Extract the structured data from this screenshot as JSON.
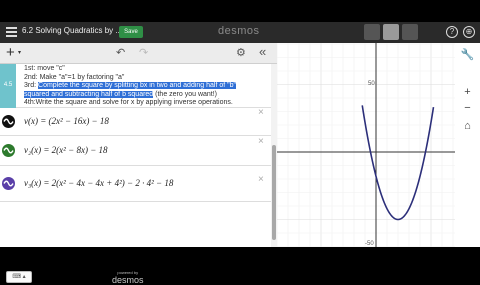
{
  "header": {
    "title": "6.2 Solving Quadratics by ...",
    "save_label": "Save",
    "brand": "desmos",
    "help_symbol": "?",
    "globe_symbol": "⊕"
  },
  "toolbar": {
    "add_symbol": "+",
    "caret": "▾",
    "undo_symbol": "↶",
    "redo_symbol": "↷",
    "gear_symbol": "⚙",
    "collapse_symbol": "«"
  },
  "note": {
    "tab_label": "4.5",
    "lines": [
      {
        "before": "1st: move \"c\"",
        "highlight": "",
        "after": ""
      },
      {
        "before": "2nd: Make \"a\"=1 by factoring \"a\"",
        "highlight": "",
        "after": ""
      },
      {
        "before": "3rd: ",
        "highlight": "Complete the square by splitting bx in two and adding half of \"b\"",
        "after": ""
      },
      {
        "before": "",
        "highlight": "squared and subtracting half of b squared",
        "after": " (the zero you want!)"
      },
      {
        "before": "4th:Write the square and solve for x by applying inverse operations.",
        "highlight": "",
        "after": ""
      }
    ]
  },
  "expressions": [
    {
      "latex": "v(x) = (2x² − 16x)      − 18",
      "color": "#111111",
      "close": "×"
    },
    {
      "latex": "v₂(x) = 2(x² − 8x)         − 18",
      "color": "#2d7a2d",
      "close": "×"
    },
    {
      "latex": "v₃(x) = 2(x² − 4x − 4x + 4²) − 2 · 4² − 18",
      "color": "#5a3fa8",
      "close": "×"
    }
  ],
  "footer": {
    "keypad_label": "⌨ ▴",
    "powered_by": "powered by",
    "powered_brand": "desmos"
  },
  "graph": {
    "y_tick_labels": [
      "50",
      "-50"
    ],
    "function": "2x^2 - 16x - 18",
    "curve_color": "#2c2f7a"
  },
  "graph_tools": {
    "wrench_symbol": "🔧",
    "zoom_in_symbol": "+",
    "zoom_out_symbol": "−",
    "home_symbol": "⌂"
  }
}
